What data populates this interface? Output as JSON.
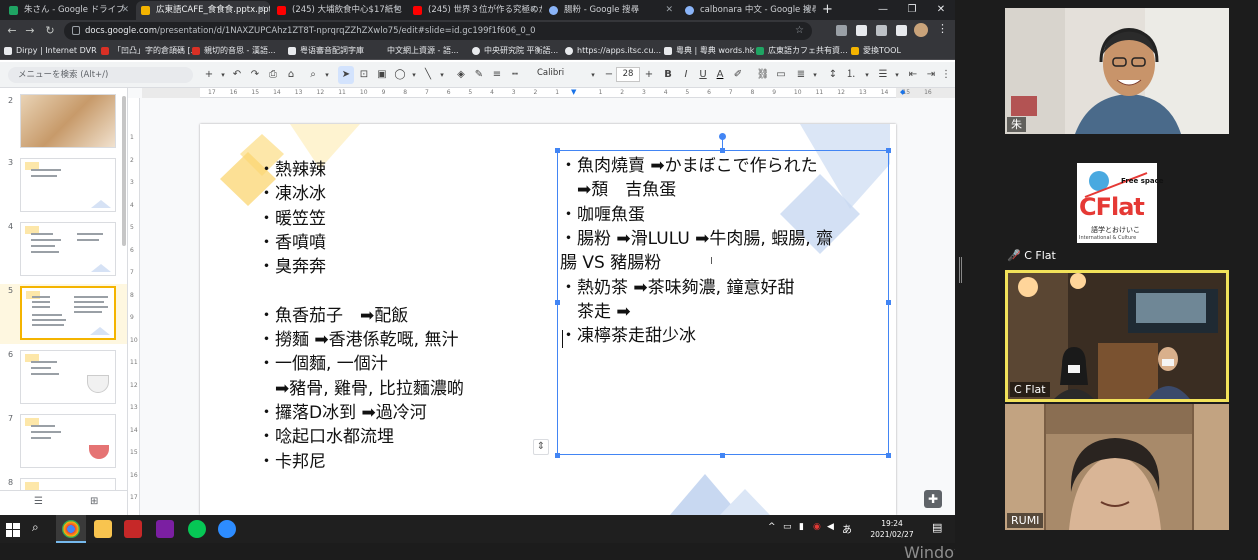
{
  "browser": {
    "tabs": [
      {
        "title": "朱さん - Google ドライブ",
        "color": "#1fa463"
      },
      {
        "title": "広東語CAFE_食食食.pptx.ppt",
        "color": "#f4b400"
      },
      {
        "title": "(245) 大埔飲食中心$17紙包",
        "color": "#ff0000"
      },
      {
        "title": "(245) 世界３位が作る究極のか",
        "color": "#ff0000"
      },
      {
        "title": "腸粉 - Google 搜尋",
        "color": "#8ab4f8"
      },
      {
        "title": "calbonara 中文 - Google 搜尋",
        "color": "#8ab4f8"
      }
    ],
    "new_tab": "+",
    "url_host": "docs.google.com",
    "url_path": "/presentation/d/1NAXZUPCAhz1ZT8T-nprqrqZZhZXwlo75/edit#slide=id.gc199f1f606_0_0",
    "bookmarks": [
      "Dirpy | Internet DVR",
      "「凹凸」字的倉頡碼 [...",
      "親切的音思 - 漢語...",
      "粤语審音配詞字庫",
      "中文網上資源 - 語...",
      "中央研究院 平衡語...",
      "https://apps.itsc.cu...",
      "粵典 | 粵典 words.hk",
      "広東語カフェ共有資...",
      "愛換TOOL"
    ]
  },
  "toolbar": {
    "menu_search": "メニューを検索 (Alt+/)",
    "font": "Calibri",
    "font_size": "28"
  },
  "filmstrip": {
    "slides": [
      {
        "num": "2"
      },
      {
        "num": "3"
      },
      {
        "num": "4"
      },
      {
        "num": "5"
      },
      {
        "num": "6"
      },
      {
        "num": "7"
      },
      {
        "num": "8"
      }
    ],
    "selected": "5"
  },
  "ruler": {
    "top_ticks": [
      "17",
      "16",
      "15",
      "14",
      "13",
      "12",
      "11",
      "10",
      "9",
      "8",
      "7",
      "6",
      "5",
      "4",
      "3",
      "2",
      "1",
      "",
      "1",
      "2",
      "3",
      "4",
      "5",
      "6",
      "7",
      "8",
      "9",
      "10",
      "11",
      "12",
      "13",
      "14",
      "15",
      "16"
    ],
    "left_ticks": [
      "1",
      "2",
      "3",
      "4",
      "5",
      "6",
      "7",
      "8",
      "9",
      "10",
      "11",
      "12",
      "13",
      "14",
      "15",
      "16",
      "17"
    ]
  },
  "slide": {
    "left_list": [
      "・熱辣辣",
      "・凍冰冰",
      "・暖笠笠",
      "・香噴噴",
      "・臭奔奔",
      "",
      "・魚香茄子　➡配飯",
      "・撈麵 ➡香港係乾嘅, 無汁",
      "・一個麵, 一個汁",
      "　➡豬骨, 雞骨, 比拉麵濃啲",
      "・攞落D冰到 ➡過冷河",
      "・唸起口水都流埋",
      "・卡邦尼"
    ],
    "right_list": [
      "・魚肉燒賣 ➡かまぼこで作られた",
      "　➡頹　吉魚蛋",
      "・咖喱魚蛋",
      "・腸粉 ➡滑LULU ➡牛肉腸, 蝦腸, 齋",
      "腸 VS 豬腸粉",
      "・熱奶茶 ➡茶味夠濃, 鐘意好甜",
      "　茶走 ➡",
      "・凍檸茶走甜少冰"
    ]
  },
  "taskbar": {
    "time": "19:24",
    "date": "2021/02/27",
    "ime": "あ"
  },
  "watermark": "Windows のライセンス認証",
  "zoom": {
    "participants": [
      {
        "name": "朱"
      },
      {
        "name": "C Flat",
        "muted": true
      },
      {
        "name": "C Flat",
        "speaking": true
      },
      {
        "name": "RUMI"
      }
    ],
    "logo": {
      "top": "Free space",
      "main": "CFlat",
      "sub": "語学とおけいこ",
      "sub2": "International & Culture"
    }
  }
}
